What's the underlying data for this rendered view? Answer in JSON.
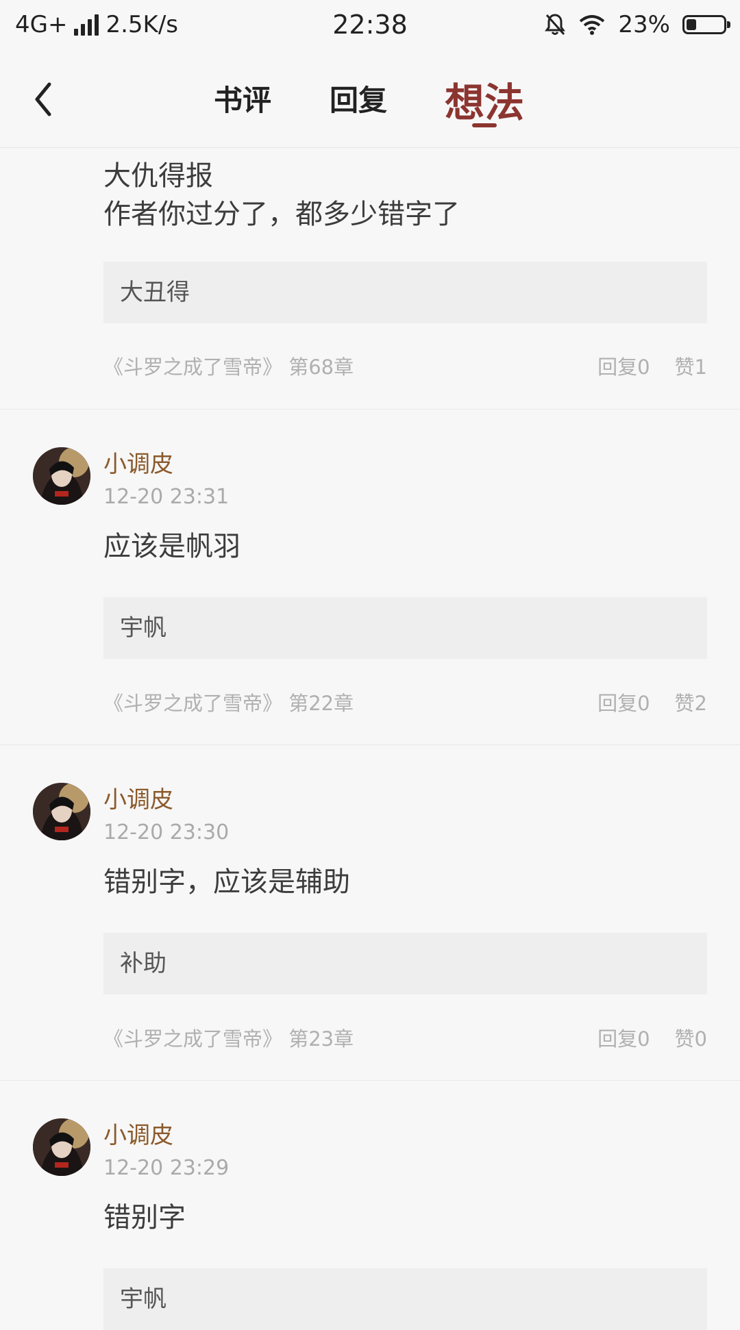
{
  "status_bar": {
    "network": "4G+",
    "speed": "2.5K/s",
    "time": "22:38",
    "battery": "23%"
  },
  "nav": {
    "tabs": [
      "书评",
      "回复",
      "想法"
    ],
    "active_tab": "想法"
  },
  "items": [
    {
      "content_lines": [
        "大仇得报",
        "作者你过分了，都多少错字了"
      ],
      "quote": "大丑得",
      "source": "《斗罗之成了雪帝》 第68章",
      "replies": "回复0",
      "likes": "赞1"
    },
    {
      "username": "小调皮",
      "time": "12-20 23:31",
      "content": "应该是帆羽",
      "quote": "宇帆",
      "source": "《斗罗之成了雪帝》 第22章",
      "replies": "回复0",
      "likes": "赞2"
    },
    {
      "username": "小调皮",
      "time": "12-20 23:30",
      "content": "错别字，应该是辅助",
      "quote": "补助",
      "source": "《斗罗之成了雪帝》 第23章",
      "replies": "回复0",
      "likes": "赞0"
    },
    {
      "username": "小调皮",
      "time": "12-20 23:29",
      "content": "错别字",
      "quote": "宇帆"
    }
  ],
  "colors": {
    "accent": "#8c3530",
    "username": "#8b5a2b",
    "muted": "#b0b0b0"
  }
}
